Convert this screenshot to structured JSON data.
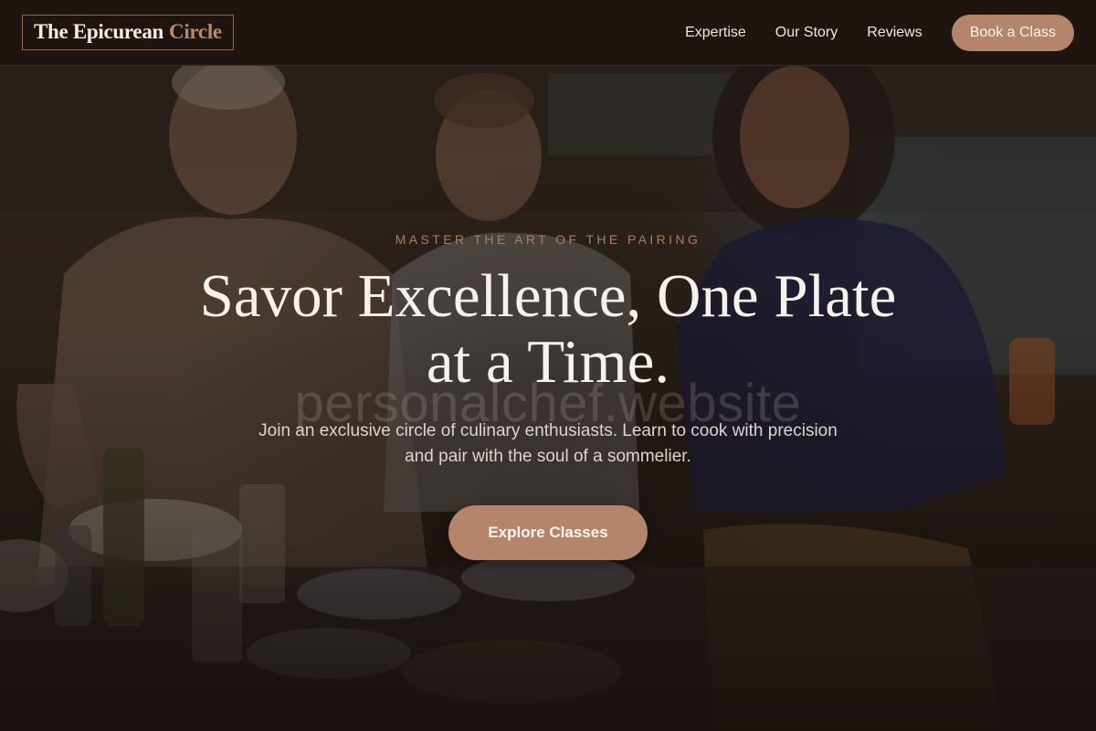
{
  "nav": {
    "logo_part1": "The Epicurean",
    "logo_part2": "Circle",
    "links": [
      "Expertise",
      "Our Story",
      "Reviews"
    ],
    "cta": "Book a Class"
  },
  "hero": {
    "background_image": "people-cooking-kitchen-photo",
    "eyebrow": "MASTER THE ART OF THE PAIRING",
    "headline_line1": "Savor Excellence, One Plate",
    "headline_line2": "at a Time.",
    "watermark": "personalchef.website",
    "subtitle": "Join an exclusive circle of culinary enthusiasts. Learn to cook with precision and pair with the soul of a sommelier.",
    "cta": "Explore Classes"
  },
  "colors": {
    "nav_background": "#1e1510",
    "accent": "#b4856a",
    "eyebrow": "#a97e63",
    "headline": "#f7f2ec",
    "body_text": "#ddd5cc"
  }
}
